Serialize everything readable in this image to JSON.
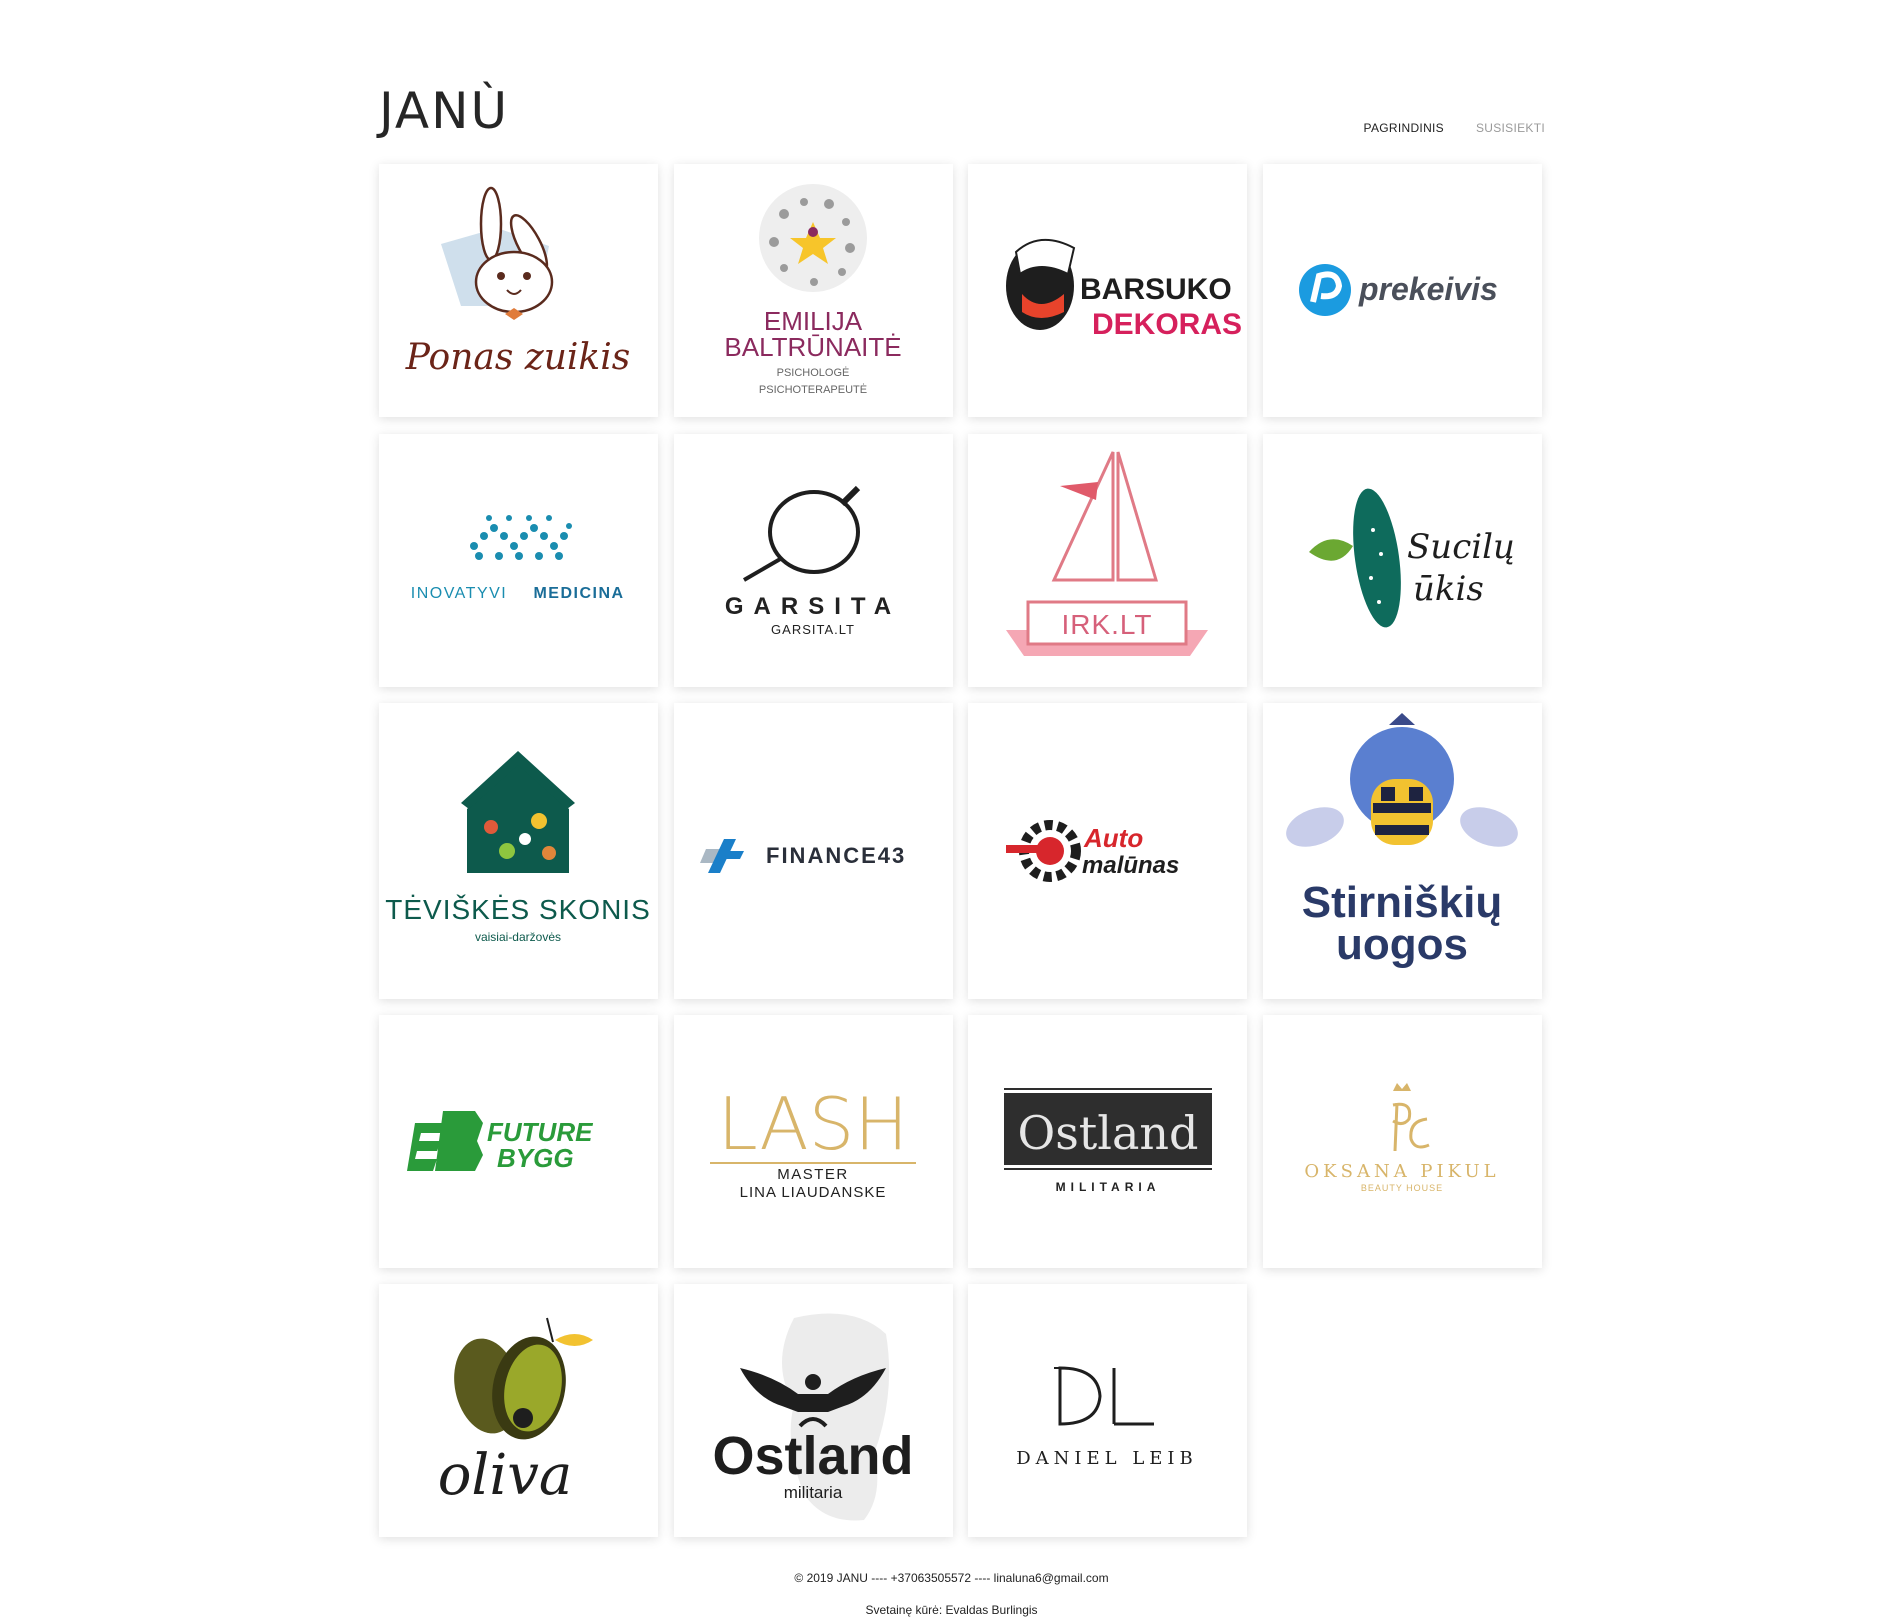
{
  "brand": {
    "name": "JANÙ"
  },
  "nav": {
    "items": [
      {
        "label": "PAGRINDINIS"
      },
      {
        "label": "SUSISIEKTI"
      }
    ]
  },
  "portfolio": {
    "items": [
      {
        "title": "Ponas zuikis"
      },
      {
        "title": "EMILIJA",
        "title2": "BALTRŪNAITĖ",
        "sub1": "PSICHOLOGĖ",
        "sub2": "PSICHOTERAPEUTĖ"
      },
      {
        "title": "BARSUKO",
        "title2": "DEKORAS"
      },
      {
        "title": "prekeivis"
      },
      {
        "title": "INOVATYVI",
        "title2": "MEDICINA"
      },
      {
        "title": "GARSITA",
        "sub1": "GARSITA.LT"
      },
      {
        "title": "IRK.LT"
      },
      {
        "title": "Sucilų",
        "title2": "ūkis"
      },
      {
        "title": "TĖVIŠKĖS SKONIS",
        "sub1": "vaisiai-daržovės"
      },
      {
        "title": "FINANCE43"
      },
      {
        "title": "Auto",
        "title2": "malūnas"
      },
      {
        "title": "Stirniškių",
        "title2": "uogos"
      },
      {
        "title": "FUTURE",
        "title2": "BYGG"
      },
      {
        "title": "LASH",
        "sub1": "MASTER",
        "sub2": "LINA LIAUDANSKE"
      },
      {
        "title": "Ostland",
        "sub1": "MILITARIA"
      },
      {
        "title": "OKSANA PIKUL",
        "sub1": "BEAUTY HOUSE"
      },
      {
        "title": "oliva"
      },
      {
        "title": "Ostland",
        "sub1": "militaria"
      },
      {
        "title": "DANIEL LEIB"
      }
    ]
  },
  "footer": {
    "line1": "© 2019 JANU ---- +37063505572 ---- linaluna6@gmail.com",
    "line2": "Svetainę kūrė: Evaldas Burlingis"
  },
  "colors": {
    "background": "#ffffff",
    "card_shadow": "#d9d9d9",
    "nav_muted": "#9a9a9a"
  }
}
